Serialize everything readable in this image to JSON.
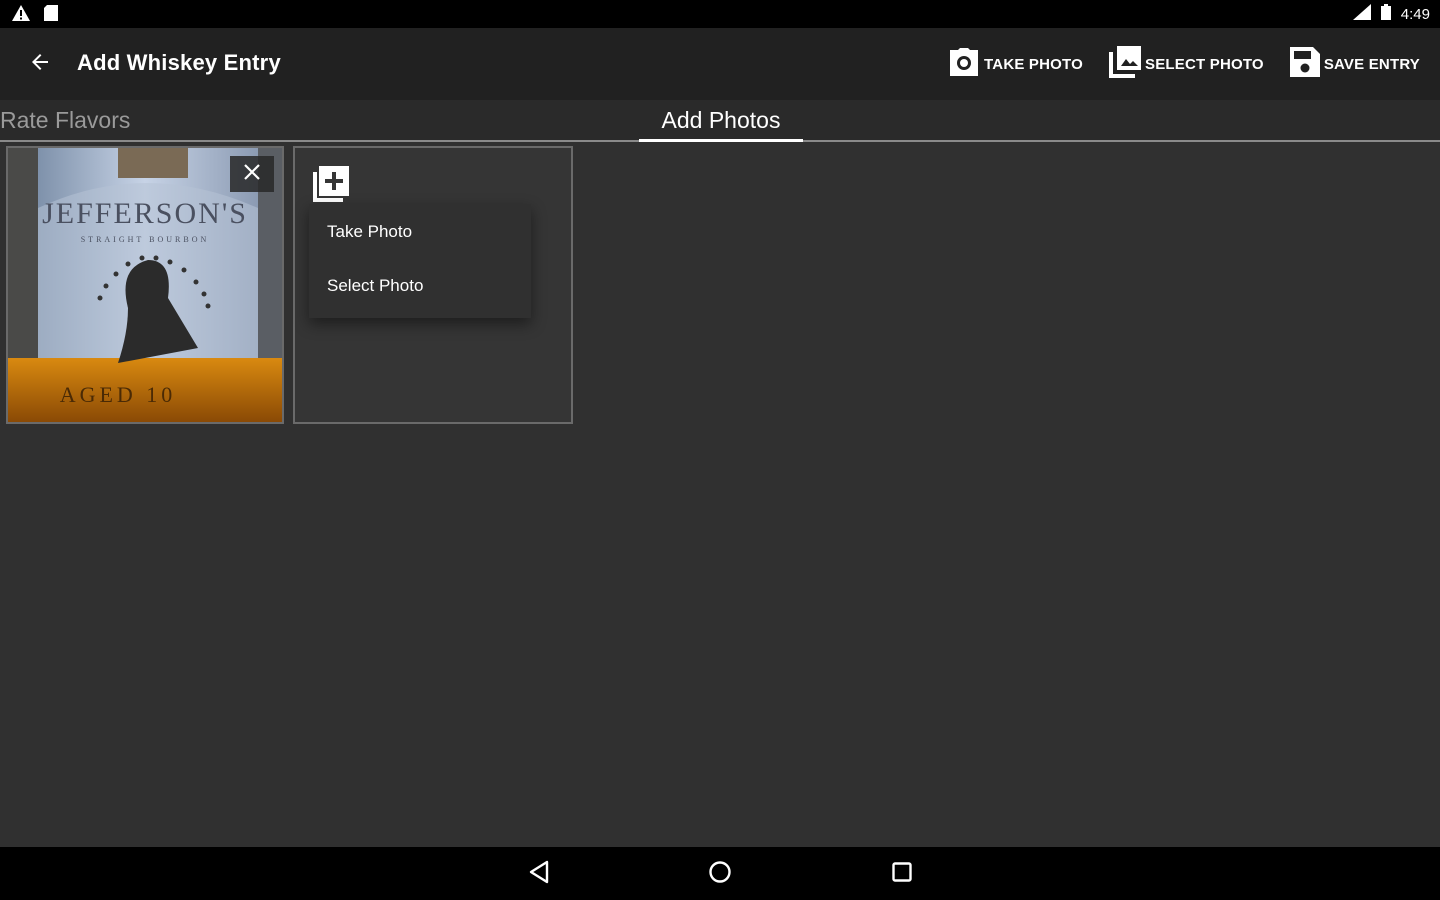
{
  "status_bar": {
    "time": "4:49",
    "icons": [
      "warning-icon",
      "sd-card-icon",
      "signal-icon",
      "battery-icon"
    ]
  },
  "app_bar": {
    "title": "Add Whiskey Entry",
    "back_icon": "arrow-back-icon",
    "actions": [
      {
        "label": "TAKE PHOTO",
        "icon": "camera-icon"
      },
      {
        "label": "SELECT PHOTO",
        "icon": "photo-library-icon"
      },
      {
        "label": "SAVE ENTRY",
        "icon": "save-icon"
      }
    ]
  },
  "tabs": [
    {
      "label": "Rate Flavors",
      "active": false
    },
    {
      "label": "Add Photos",
      "active": true
    }
  ],
  "photo": {
    "remove_icon": "close-icon",
    "label_text": "JEFFERSON'S",
    "sub_text": "STRAIGHT BOURBON",
    "aged_text": "AGED 10"
  },
  "add_menu": {
    "icon": "add-to-photos-icon",
    "items": [
      "Take Photo",
      "Select Photo"
    ]
  },
  "nav_bar": {
    "icons": [
      "back-triangle-icon",
      "home-circle-icon",
      "recents-square-icon"
    ]
  },
  "colors": {
    "background": "#303030",
    "app_bar": "#212121",
    "status_bar": "#000000",
    "tab_indicator": "#ffffff",
    "inactive_tab": "#9a9a9a"
  }
}
